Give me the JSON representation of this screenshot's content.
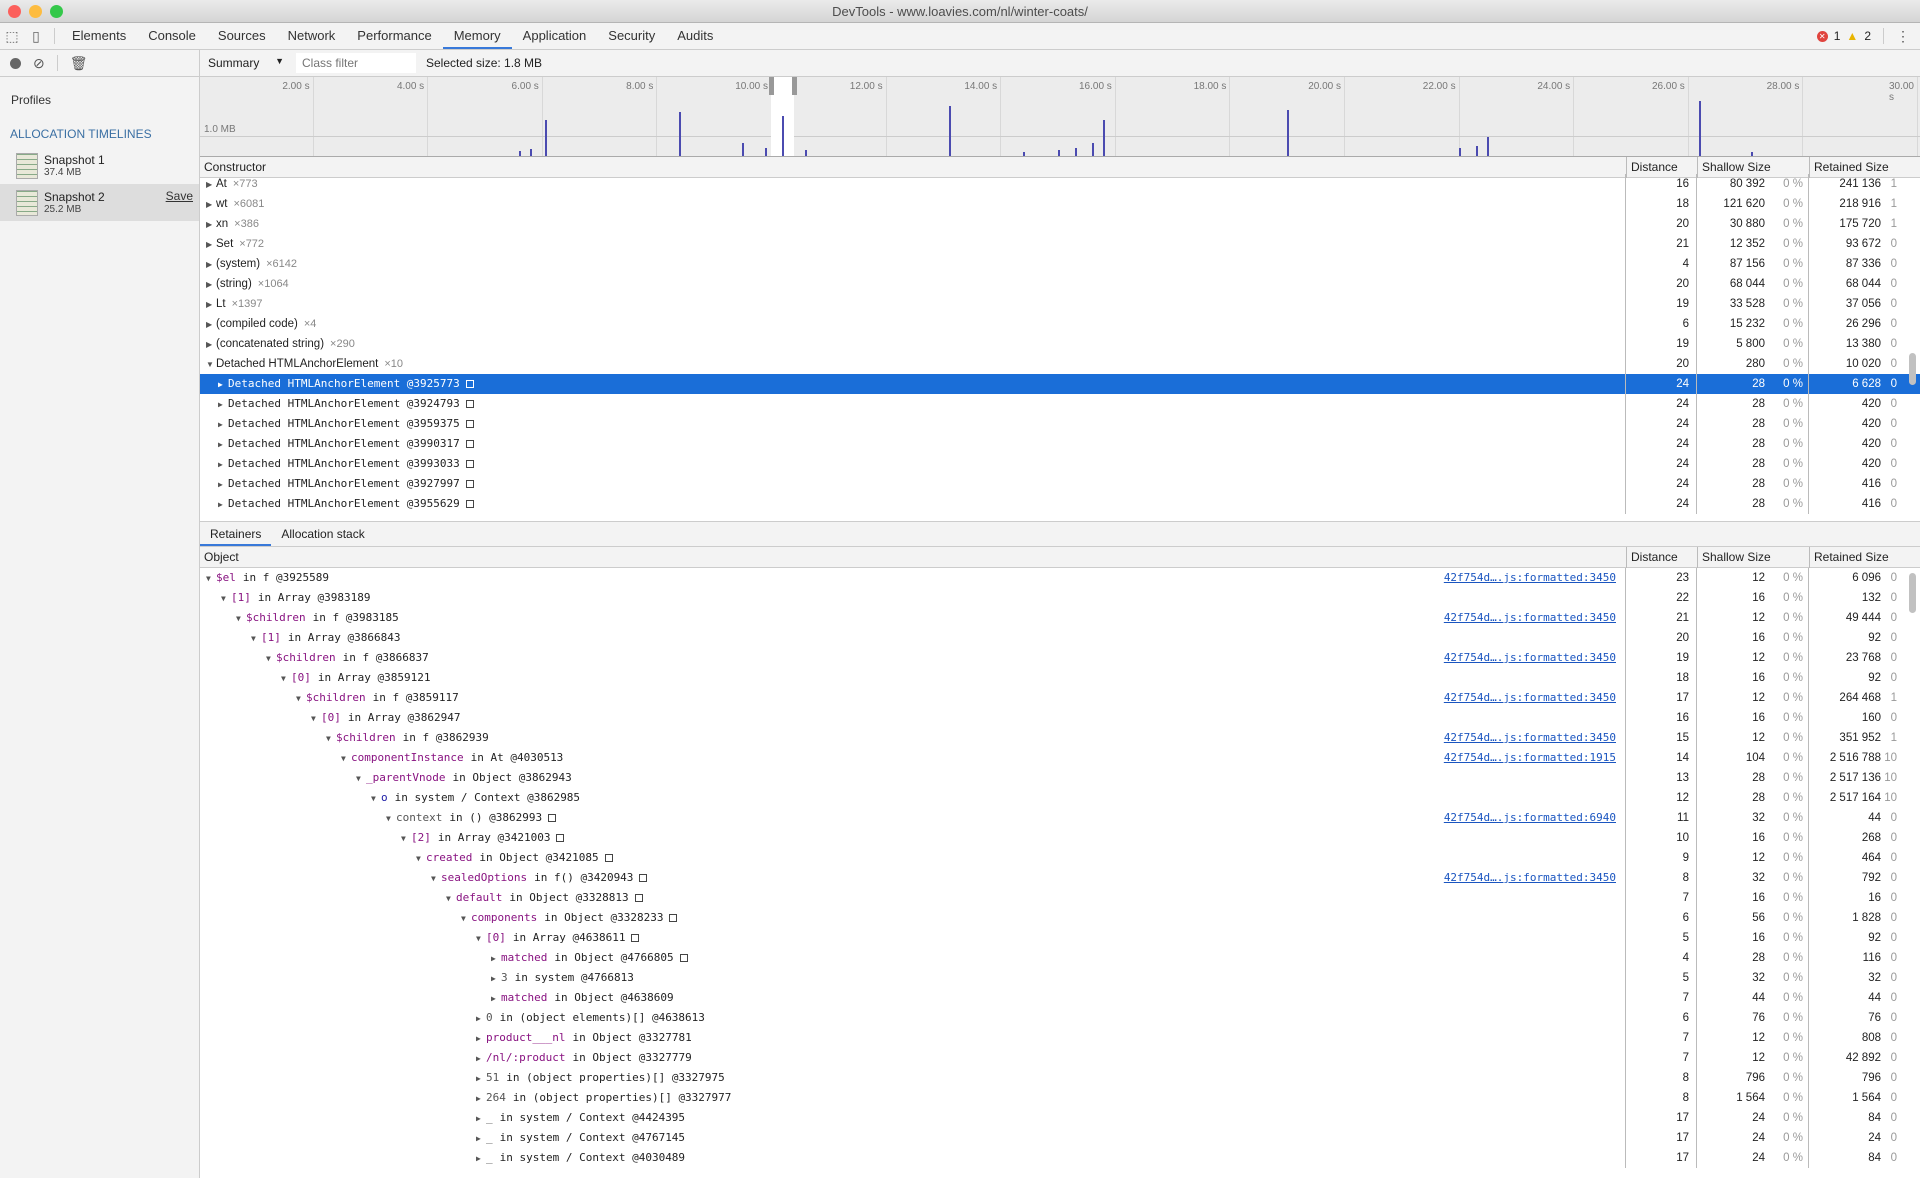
{
  "window": {
    "title": "DevTools - www.loavies.com/nl/winter-coats/"
  },
  "tabs": [
    "Elements",
    "Console",
    "Sources",
    "Network",
    "Performance",
    "Memory",
    "Application",
    "Security",
    "Audits"
  ],
  "active_tab": "Memory",
  "status": {
    "errors": "1",
    "warnings": "2"
  },
  "sidebar": {
    "heading": "Profiles",
    "section": "ALLOCATION TIMELINES",
    "snapshots": [
      {
        "name": "Snapshot 1",
        "size": "37.4 MB"
      },
      {
        "name": "Snapshot 2",
        "size": "25.2 MB",
        "action": "Save"
      }
    ]
  },
  "toolbar": {
    "view": "Summary",
    "filter_placeholder": "Class filter",
    "selected_size": "Selected size: 1.8 MB"
  },
  "timeline": {
    "ticks": [
      "2.00 s",
      "4.00 s",
      "6.00 s",
      "8.00 s",
      "10.00 s",
      "12.00 s",
      "14.00 s",
      "16.00 s",
      "18.00 s",
      "20.00 s",
      "22.00 s",
      "24.00 s",
      "26.00 s",
      "28.00 s",
      "30.00 s"
    ],
    "scale_label": "1.0 MB",
    "selection_s": [
      10.0,
      10.4
    ],
    "spikes_mb": [
      [
        5.6,
        0.25
      ],
      [
        5.8,
        0.35
      ],
      [
        6.05,
        1.7
      ],
      [
        8.4,
        2.1
      ],
      [
        9.5,
        0.6
      ],
      [
        9.9,
        0.4
      ],
      [
        10.2,
        1.9
      ],
      [
        10.6,
        0.3
      ],
      [
        13.1,
        2.4
      ],
      [
        14.4,
        0.2
      ],
      [
        15.0,
        0.3
      ],
      [
        15.3,
        0.4
      ],
      [
        15.6,
        0.6
      ],
      [
        15.8,
        1.7
      ],
      [
        19.0,
        2.2
      ],
      [
        22.0,
        0.4
      ],
      [
        22.3,
        0.5
      ],
      [
        22.5,
        0.9
      ],
      [
        26.2,
        2.6
      ],
      [
        27.1,
        0.2
      ]
    ],
    "bar_color": "#4b4bb0"
  },
  "constructor_table": {
    "headers": [
      "Constructor",
      "Distance",
      "Shallow Size",
      "Retained Size"
    ],
    "rows": [
      {
        "name": "At",
        "count": "×773",
        "dist": "16",
        "shallow": "80 392",
        "sp": "0 %",
        "retained": "241 136",
        "rp": "1",
        "level": 0,
        "open": false
      },
      {
        "name": "wt",
        "count": "×6081",
        "dist": "18",
        "shallow": "121 620",
        "sp": "0 %",
        "retained": "218 916",
        "rp": "1",
        "level": 0,
        "open": false
      },
      {
        "name": "xn",
        "count": "×386",
        "dist": "20",
        "shallow": "30 880",
        "sp": "0 %",
        "retained": "175 720",
        "rp": "1",
        "level": 0,
        "open": false
      },
      {
        "name": "Set",
        "count": "×772",
        "dist": "21",
        "shallow": "12 352",
        "sp": "0 %",
        "retained": "93 672",
        "rp": "0",
        "level": 0,
        "open": false
      },
      {
        "name": "(system)",
        "count": "×6142",
        "dist": "4",
        "shallow": "87 156",
        "sp": "0 %",
        "retained": "87 336",
        "rp": "0",
        "level": 0,
        "open": false
      },
      {
        "name": "(string)",
        "count": "×1064",
        "dist": "20",
        "shallow": "68 044",
        "sp": "0 %",
        "retained": "68 044",
        "rp": "0",
        "level": 0,
        "open": false
      },
      {
        "name": "Lt",
        "count": "×1397",
        "dist": "19",
        "shallow": "33 528",
        "sp": "0 %",
        "retained": "37 056",
        "rp": "0",
        "level": 0,
        "open": false
      },
      {
        "name": "(compiled code)",
        "count": "×4",
        "dist": "6",
        "shallow": "15 232",
        "sp": "0 %",
        "retained": "26 296",
        "rp": "0",
        "level": 0,
        "open": false
      },
      {
        "name": "(concatenated string)",
        "count": "×290",
        "dist": "19",
        "shallow": "5 800",
        "sp": "0 %",
        "retained": "13 380",
        "rp": "0",
        "level": 0,
        "open": false
      },
      {
        "name": "Detached HTMLAnchorElement",
        "count": "×10",
        "dist": "20",
        "shallow": "280",
        "sp": "0 %",
        "retained": "10 020",
        "rp": "0",
        "level": 0,
        "open": true
      },
      {
        "name": "Detached HTMLAnchorElement @3925773",
        "dist": "24",
        "shallow": "28",
        "sp": "0 %",
        "retained": "6 628",
        "rp": "0",
        "level": 1,
        "open": false,
        "selected": true
      },
      {
        "name": "Detached HTMLAnchorElement @3924793",
        "dist": "24",
        "shallow": "28",
        "sp": "0 %",
        "retained": "420",
        "rp": "0",
        "level": 1,
        "open": false
      },
      {
        "name": "Detached HTMLAnchorElement @3959375",
        "dist": "24",
        "shallow": "28",
        "sp": "0 %",
        "retained": "420",
        "rp": "0",
        "level": 1,
        "open": false
      },
      {
        "name": "Detached HTMLAnchorElement @3990317",
        "dist": "24",
        "shallow": "28",
        "sp": "0 %",
        "retained": "420",
        "rp": "0",
        "level": 1,
        "open": false
      },
      {
        "name": "Detached HTMLAnchorElement @3993033",
        "dist": "24",
        "shallow": "28",
        "sp": "0 %",
        "retained": "420",
        "rp": "0",
        "level": 1,
        "open": false
      },
      {
        "name": "Detached HTMLAnchorElement @3927997",
        "dist": "24",
        "shallow": "28",
        "sp": "0 %",
        "retained": "416",
        "rp": "0",
        "level": 1,
        "open": false
      },
      {
        "name": "Detached HTMLAnchorElement @3955629",
        "dist": "24",
        "shallow": "28",
        "sp": "0 %",
        "retained": "416",
        "rp": "0",
        "level": 1,
        "open": false
      }
    ]
  },
  "lower_tabs": [
    "Retainers",
    "Allocation stack"
  ],
  "retainers_table": {
    "headers": [
      "Object",
      "Distance",
      "Shallow Size",
      "Retained Size"
    ],
    "rows": [
      {
        "l": 0,
        "o": 1,
        "n": "$el",
        "k": "prop",
        "r": "in f @3925589",
        "link": "42f754d….js:formatted:3450",
        "d": "23",
        "s": "12",
        "rt": "6 096",
        "rp": "0"
      },
      {
        "l": 1,
        "o": 1,
        "n": "[1]",
        "k": "prop",
        "r": "in Array @3983189",
        "d": "22",
        "s": "16",
        "rt": "132",
        "rp": "0"
      },
      {
        "l": 2,
        "o": 1,
        "n": "$children",
        "k": "prop",
        "r": "in f @3983185",
        "link": "42f754d….js:formatted:3450",
        "d": "21",
        "s": "12",
        "rt": "49 444",
        "rp": "0"
      },
      {
        "l": 3,
        "o": 1,
        "n": "[1]",
        "k": "prop",
        "r": "in Array @3866843",
        "d": "20",
        "s": "16",
        "rt": "92",
        "rp": "0"
      },
      {
        "l": 4,
        "o": 1,
        "n": "$children",
        "k": "prop",
        "r": "in f @3866837",
        "link": "42f754d….js:formatted:3450",
        "d": "19",
        "s": "12",
        "rt": "23 768",
        "rp": "0"
      },
      {
        "l": 5,
        "o": 1,
        "n": "[0]",
        "k": "prop",
        "r": "in Array @3859121",
        "d": "18",
        "s": "16",
        "rt": "92",
        "rp": "0"
      },
      {
        "l": 6,
        "o": 1,
        "n": "$children",
        "k": "prop",
        "r": "in f @3859117",
        "link": "42f754d….js:formatted:3450",
        "d": "17",
        "s": "12",
        "rt": "264 468",
        "rp": "1"
      },
      {
        "l": 7,
        "o": 1,
        "n": "[0]",
        "k": "prop",
        "r": "in Array @3862947",
        "d": "16",
        "s": "16",
        "rt": "160",
        "rp": "0"
      },
      {
        "l": 8,
        "o": 1,
        "n": "$children",
        "k": "prop",
        "r": "in f @3862939",
        "link": "42f754d….js:formatted:3450",
        "d": "15",
        "s": "12",
        "rt": "351 952",
        "rp": "1"
      },
      {
        "l": 9,
        "o": 1,
        "n": "componentInstance",
        "k": "prop",
        "r": "in At @4030513",
        "link": "42f754d….js:formatted:1915",
        "d": "14",
        "s": "104",
        "rt": "2 516 788",
        "rp": "10"
      },
      {
        "l": 10,
        "o": 1,
        "n": "_parentVnode",
        "k": "prop",
        "r": "in Object @3862943",
        "d": "13",
        "s": "28",
        "rt": "2 517 136",
        "rp": "10"
      },
      {
        "l": 11,
        "o": 1,
        "n": "o",
        "k": "blue",
        "r": "in system / Context @3862985",
        "d": "12",
        "s": "28",
        "rt": "2 517 164",
        "rp": "10"
      },
      {
        "l": 12,
        "o": 1,
        "n": "context",
        "k": "gray",
        "r": "in () @3862993",
        "box": 1,
        "link": "42f754d….js:formatted:6940",
        "d": "11",
        "s": "32",
        "rt": "44",
        "rp": "0"
      },
      {
        "l": 13,
        "o": 1,
        "n": "[2]",
        "k": "prop",
        "r": "in Array @3421003",
        "box": 1,
        "d": "10",
        "s": "16",
        "rt": "268",
        "rp": "0"
      },
      {
        "l": 14,
        "o": 1,
        "n": "created",
        "k": "prop",
        "r": "in Object @3421085",
        "box": 1,
        "d": "9",
        "s": "12",
        "rt": "464",
        "rp": "0"
      },
      {
        "l": 15,
        "o": 1,
        "n": "sealedOptions",
        "k": "prop",
        "r": "in f() @3420943",
        "box": 1,
        "link": "42f754d….js:formatted:3450",
        "d": "8",
        "s": "32",
        "rt": "792",
        "rp": "0"
      },
      {
        "l": 16,
        "o": 1,
        "n": "default",
        "k": "prop",
        "r": "in Object @3328813",
        "box": 1,
        "d": "7",
        "s": "16",
        "rt": "16",
        "rp": "0"
      },
      {
        "l": 17,
        "o": 1,
        "n": "components",
        "k": "prop",
        "r": "in Object @3328233",
        "box": 1,
        "d": "6",
        "s": "56",
        "rt": "1 828",
        "rp": "0"
      },
      {
        "l": 18,
        "o": 1,
        "n": "[0]",
        "k": "prop",
        "r": "in Array @4638611",
        "box": 1,
        "d": "5",
        "s": "16",
        "rt": "92",
        "rp": "0"
      },
      {
        "l": 19,
        "o": 0,
        "n": "matched",
        "k": "prop",
        "r": "in Object @4766805",
        "box": 1,
        "d": "4",
        "s": "28",
        "rt": "116",
        "rp": "0"
      },
      {
        "l": 19,
        "o": 0,
        "n": "3",
        "k": "gray",
        "r": "in system @4766813",
        "d": "5",
        "s": "32",
        "rt": "32",
        "rp": "0"
      },
      {
        "l": 19,
        "o": 0,
        "n": "matched",
        "k": "prop",
        "r": "in Object @4638609",
        "d": "7",
        "s": "44",
        "rt": "44",
        "rp": "0"
      },
      {
        "l": 18,
        "o": 0,
        "n": "0",
        "k": "gray",
        "r": "in (object elements)[] @4638613",
        "d": "6",
        "s": "76",
        "rt": "76",
        "rp": "0"
      },
      {
        "l": 18,
        "o": 0,
        "n": "product___nl",
        "k": "prop",
        "r": "in Object @3327781",
        "d": "7",
        "s": "12",
        "rt": "808",
        "rp": "0"
      },
      {
        "l": 18,
        "o": 0,
        "n": "/nl/:product",
        "k": "prop",
        "r": "in Object @3327779",
        "d": "7",
        "s": "12",
        "rt": "42 892",
        "rp": "0"
      },
      {
        "l": 18,
        "o": 0,
        "n": "51",
        "k": "gray",
        "r": "in (object properties)[] @3327975",
        "d": "8",
        "s": "796",
        "rt": "796",
        "rp": "0"
      },
      {
        "l": 18,
        "o": 0,
        "n": "264",
        "k": "gray",
        "r": "in (object properties)[] @3327977",
        "d": "8",
        "s": "1 564",
        "rt": "1 564",
        "rp": "0"
      },
      {
        "l": 18,
        "o": 0,
        "n": "_",
        "k": "gray",
        "r": "in system / Context @4424395",
        "d": "17",
        "s": "24",
        "rt": "84",
        "rp": "0"
      },
      {
        "l": 18,
        "o": 0,
        "n": "_",
        "k": "gray",
        "r": "in system / Context @4767145",
        "d": "17",
        "s": "24",
        "rt": "24",
        "rp": "0"
      },
      {
        "l": 18,
        "o": 0,
        "n": "_",
        "k": "gray",
        "r": "in system / Context @4030489",
        "d": "17",
        "s": "24",
        "rt": "84",
        "rp": "0"
      }
    ],
    "pct": "0 %"
  }
}
